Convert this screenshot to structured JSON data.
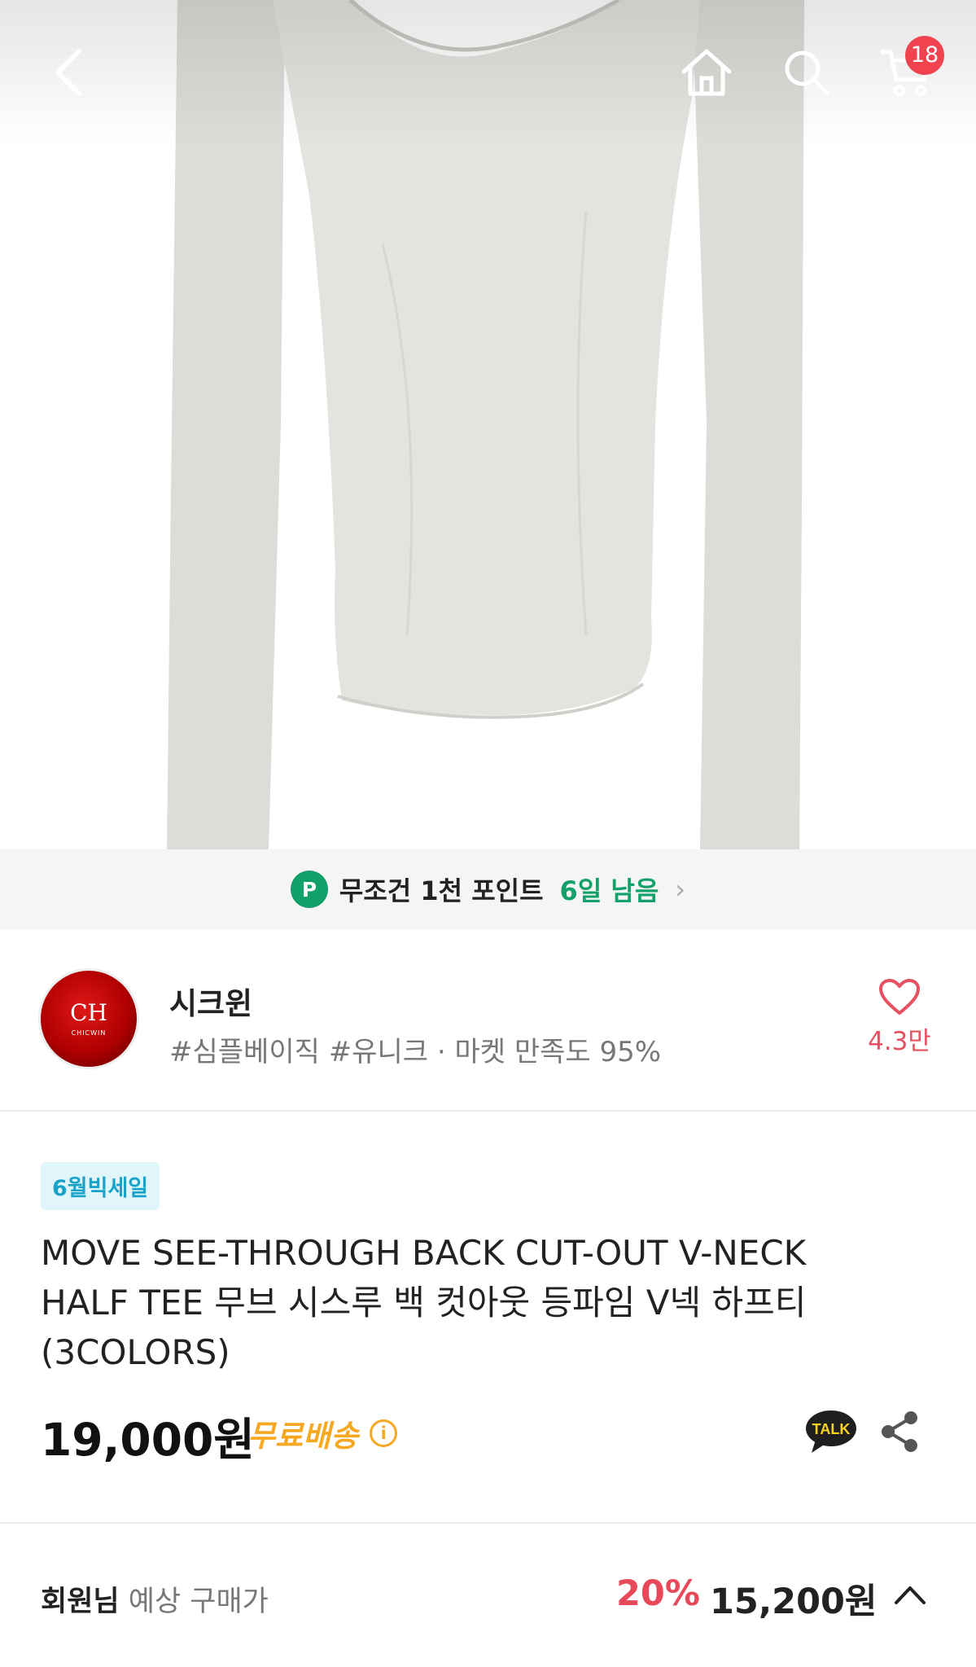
{
  "header": {
    "back_icon": "chevron-left-icon",
    "home_icon": "home-icon",
    "search_icon": "search-icon",
    "cart_icon": "cart-icon",
    "cart_count": "18"
  },
  "point_banner": {
    "badge": "P",
    "text": "무조건 1천 포인트",
    "days": "6일 남음",
    "accent": "#14a06b"
  },
  "seller": {
    "name": "시크윈",
    "meta": "#심플베이직 #유니크 · 마켓 만족도 95%",
    "like_count": "4.3만",
    "logo_brand_color": "#c00000"
  },
  "product": {
    "sale_tag": "6월빅세일",
    "title_lines": [
      "MOVE SEE-THROUGH BACK CUT-OUT  V-NECK",
      "HALF TEE 무브 시스루 백 컷아웃 등파임 V넥 하프티",
      "(3COLORS)"
    ],
    "price": "19,000원",
    "shipping_label": "무료배송",
    "shipping_info_glyph": "i",
    "talk_label": "TALK",
    "share_icon": "share-icon"
  },
  "member_price": {
    "label_bold": "회원님",
    "label": "예상 구매가",
    "discount_rate": "20%",
    "price": "15,200원",
    "toggle_icon": "chevron-up-icon"
  },
  "colors": {
    "accent_red": "#e8495a",
    "badge_red": "#f0424f",
    "shipping_orange": "#f7a823",
    "sale_tag_blue": "#1aa3c9"
  }
}
